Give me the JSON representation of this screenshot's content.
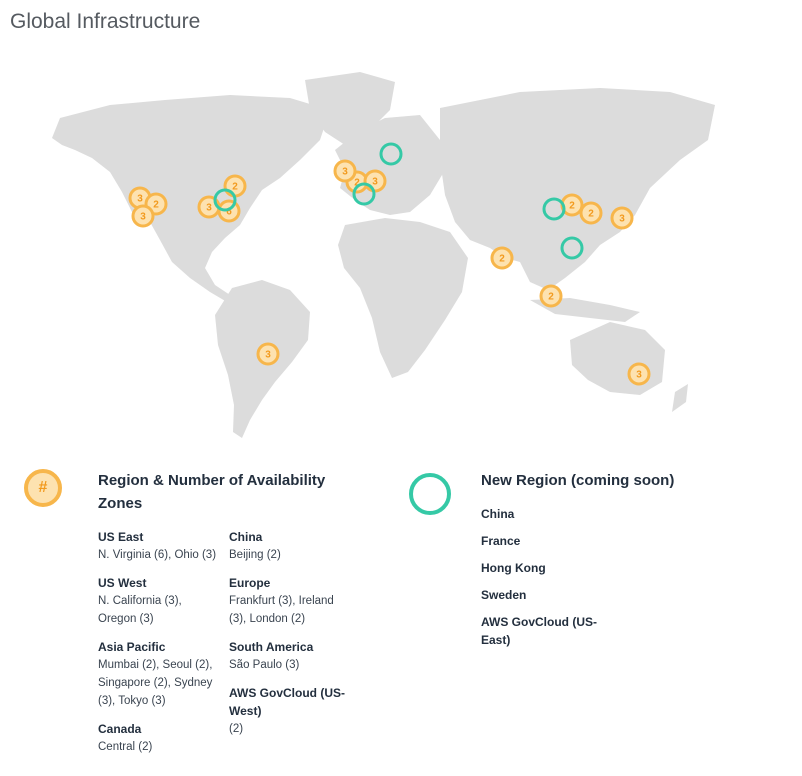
{
  "page": {
    "title": "Global Infrastructure"
  },
  "colors": {
    "land": "#dcdcdc",
    "existing_region": "#f7b64b",
    "new_region": "#35c9a6"
  },
  "markers": {
    "existing": [
      "3",
      "2",
      "3",
      "3",
      "2",
      "6",
      "3",
      "2",
      "3",
      "2",
      "2",
      "3",
      "2",
      "2",
      "3",
      "3"
    ]
  },
  "legend": {
    "existing": {
      "icon_glyph": "#",
      "title": "Region & Number of Availability Zones",
      "column1": [
        {
          "name": "US East",
          "detail": "N. Virginia (6), Ohio (3)"
        },
        {
          "name": "US West",
          "detail": "N. California (3), Oregon (3)"
        },
        {
          "name": "Asia Pacific",
          "detail": "Mumbai (2), Seoul (2), Singapore (2), Sydney (3), Tokyo (3)"
        },
        {
          "name": "Canada",
          "detail": "Central (2)"
        }
      ],
      "column2": [
        {
          "name": "China",
          "detail": "Beijing (2)"
        },
        {
          "name": "Europe",
          "detail": "Frankfurt (3), Ireland (3), London (2)"
        },
        {
          "name": "South America",
          "detail": "São Paulo (3)"
        },
        {
          "name": "AWS GovCloud (US-West)",
          "detail": "(2)"
        }
      ]
    },
    "new": {
      "title": "New Region (coming soon)",
      "items": [
        "China",
        "France",
        "Hong Kong",
        "Sweden",
        "AWS GovCloud (US-East)"
      ]
    }
  }
}
